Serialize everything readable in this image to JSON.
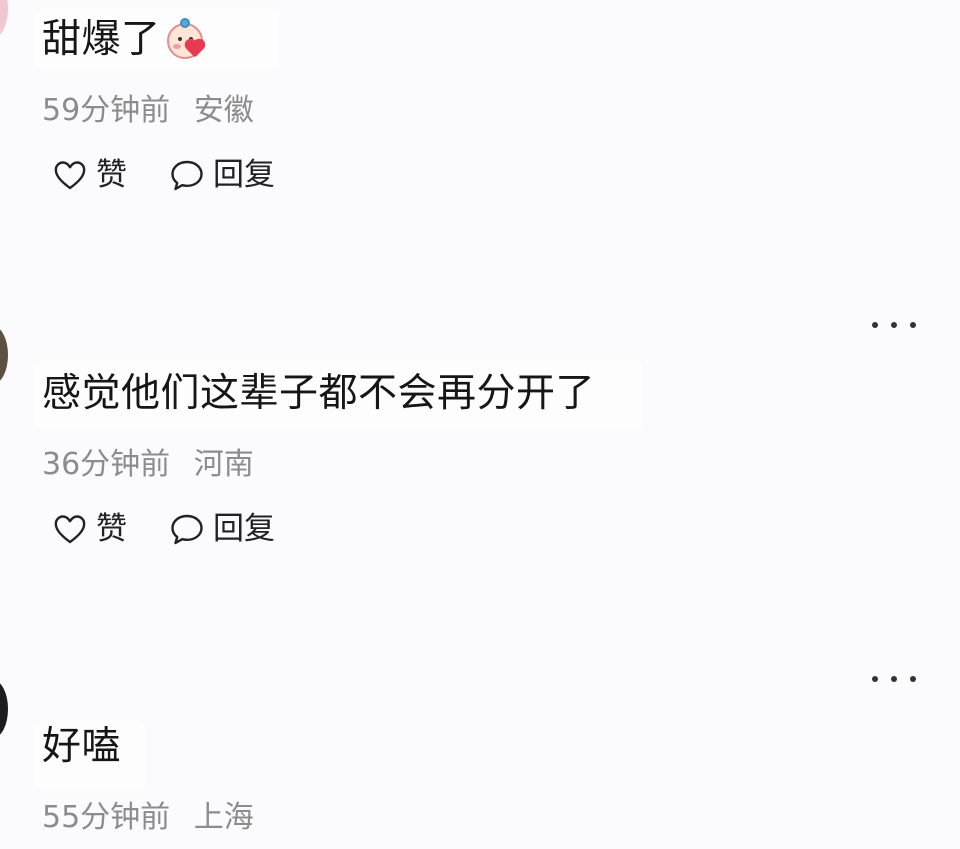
{
  "comments": [
    {
      "text": "甜爆了",
      "emoji": "blushing-face-with-heart-icon",
      "time": "59分钟前",
      "location": "安徽"
    },
    {
      "text": "感觉他们这辈子都不会再分开了",
      "time": "36分钟前",
      "location": "河南"
    },
    {
      "text": "好嗑",
      "time": "55分钟前",
      "location": "上海"
    }
  ],
  "actions": {
    "like_label": "赞",
    "reply_label": "回复"
  },
  "icons": {
    "like": "heart-outline-icon",
    "reply": "speech-bubble-outline-icon",
    "more": "more-dots-icon"
  },
  "colors": {
    "background": "#fbfbfd",
    "text": "#161616",
    "meta": "#8c8c8c"
  }
}
